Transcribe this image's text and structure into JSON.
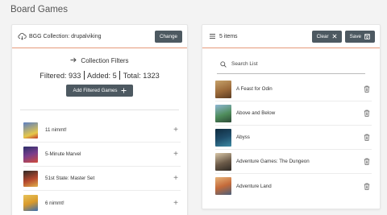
{
  "page": {
    "title": "Board Games"
  },
  "collection": {
    "header": "BGG Collection: drupalviking",
    "change_label": "Change",
    "filters_title": "Collection Filters",
    "filtered_label": "Filtered: 933",
    "added_label": "Added: 5",
    "total_label": "Total: 1323",
    "add_filtered_label": "Add Filtered Games",
    "games": [
      {
        "name": "11 nimmt!",
        "color": "#5b7fc4"
      },
      {
        "name": "5-Minute Marvel",
        "color": "#7a3d8c"
      },
      {
        "name": "51st State: Master Set",
        "color": "#b5482e"
      },
      {
        "name": "6 nimmt!",
        "color": "#d99a2b"
      }
    ]
  },
  "list": {
    "header": "5 items",
    "clear_label": "Clear",
    "save_label": "Save",
    "search_placeholder": "Search List",
    "items": [
      {
        "name": "A Feast for Odin",
        "color": "#9b6a3a"
      },
      {
        "name": "Above and Below",
        "color": "#4f8d5c"
      },
      {
        "name": "Abyss",
        "color": "#1f4d6a"
      },
      {
        "name": "Adventure Games: The Dungeon",
        "color": "#6b5a48"
      },
      {
        "name": "Adventure Land",
        "color": "#c46a3a"
      }
    ]
  }
}
